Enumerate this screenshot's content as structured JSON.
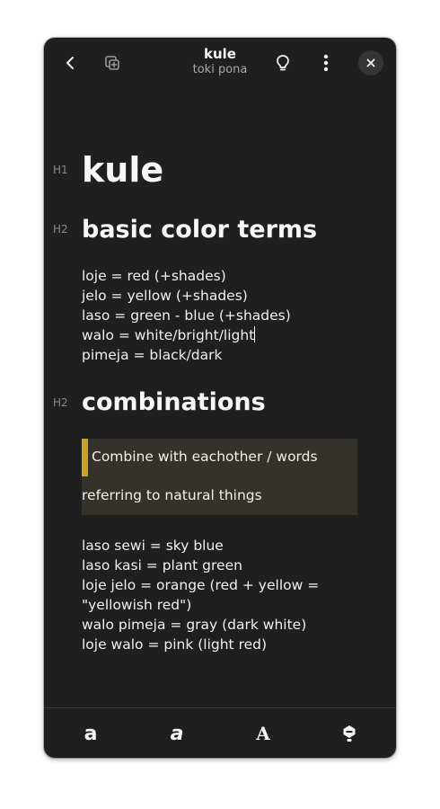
{
  "header": {
    "title": "kule",
    "subtitle": "toki pona",
    "icons": [
      "back-icon",
      "new-note-icon",
      "lightbulb-icon",
      "menu-icon",
      "close-icon"
    ]
  },
  "document": {
    "h1_marker": "H1",
    "h1": "kule",
    "sections": [
      {
        "marker": "H2",
        "heading": "basic color terms",
        "lines": [
          "loje = red (+shades)",
          "jelo = yellow (+shades)",
          "laso = green - blue (+shades)",
          "walo = white/bright/light",
          "pimeja = black/dark"
        ]
      },
      {
        "marker": "H2",
        "heading": "combinations",
        "quote": [
          "Combine with eachother / words",
          "referring to natural things"
        ],
        "lines": [
          "laso sewi = sky blue",
          "laso kasi = plant green",
          "loje jelo = orange (red + yellow =",
          "\"yellowish red\")",
          "walo pimeja = gray (dark white)",
          "loje walo = pink (light red)"
        ]
      }
    ]
  },
  "toolbar": {
    "bold_label": "a",
    "italic_label": "a",
    "heading_label": "A",
    "icons": [
      "bold-icon",
      "italic-icon",
      "heading-icon",
      "highlight-icon"
    ]
  },
  "colors": {
    "window_bg": "#1f1f1f",
    "quote_bg": "#34322b",
    "quote_accent": "#c9a227"
  }
}
